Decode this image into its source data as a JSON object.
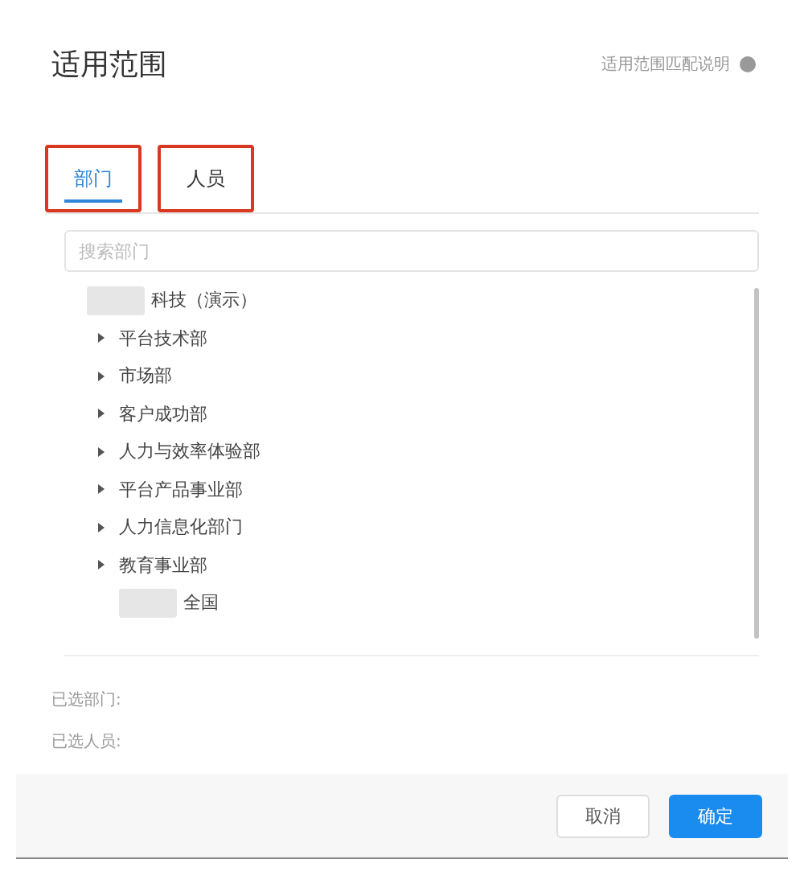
{
  "dialog": {
    "title": "适用范围",
    "help_link": "适用范围匹配说明"
  },
  "tabs": [
    {
      "label": "部门",
      "selected": true,
      "highlighted": true
    },
    {
      "label": "人员",
      "selected": false,
      "highlighted": true
    }
  ],
  "search": {
    "placeholder": "搜索部门"
  },
  "tree": [
    {
      "label": "科技（演示）",
      "redacted": true,
      "expandable": false,
      "children": [
        {
          "label": "平台技术部",
          "expandable": true,
          "redacted": false
        },
        {
          "label": "市场部",
          "expandable": true,
          "redacted": false
        },
        {
          "label": "客户成功部",
          "expandable": true,
          "redacted": false
        },
        {
          "label": "人力与效率体验部",
          "expandable": true,
          "redacted": false
        },
        {
          "label": "平台产品事业部",
          "expandable": true,
          "redacted": false
        },
        {
          "label": "人力信息化部门",
          "expandable": true,
          "redacted": false
        },
        {
          "label": "教育事业部",
          "expandable": true,
          "redacted": false
        },
        {
          "label": "全国",
          "expandable": false,
          "redacted": true
        }
      ]
    }
  ],
  "selected_summary": [
    "已选部门:",
    "已选人员:"
  ],
  "buttons": [
    {
      "label": "取消",
      "kind": "secondary"
    },
    {
      "label": "确定",
      "kind": "primary"
    }
  ]
}
